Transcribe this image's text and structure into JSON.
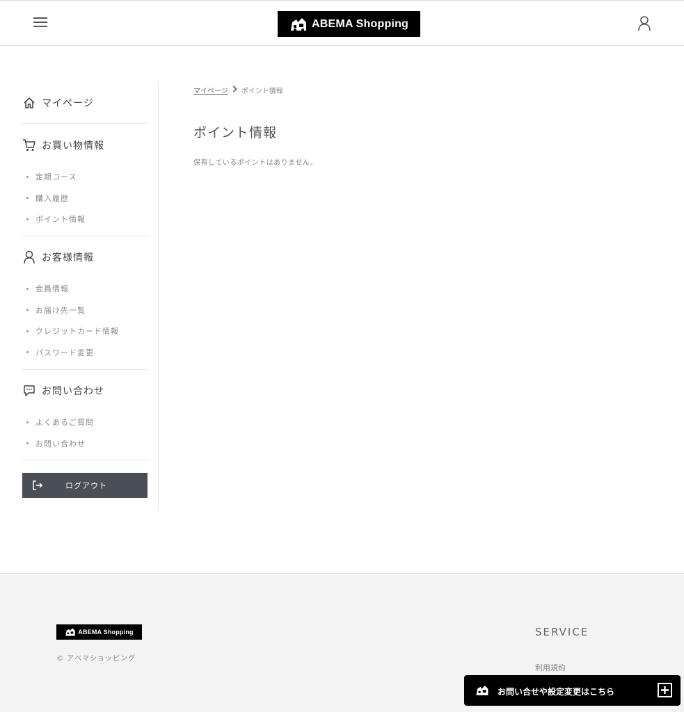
{
  "header": {
    "logo_text": "ABEMA Shopping"
  },
  "sidebar": {
    "home_label": "マイページ",
    "sections": [
      {
        "title": "お買い物情報",
        "items": [
          "定期コース",
          "購入履歴",
          "ポイント情報"
        ]
      },
      {
        "title": "お客様情報",
        "items": [
          "会員情報",
          "お届け先一覧",
          "クレジットカード情報",
          "パスワード変更"
        ]
      },
      {
        "title": "お問い合わせ",
        "items": [
          "よくあるご質問",
          "お問い合わせ"
        ]
      }
    ],
    "logout_label": "ログアウト"
  },
  "main": {
    "breadcrumb": {
      "parent": "マイページ",
      "current": "ポイント情報"
    },
    "title": "ポイント情報",
    "empty_message": "保有しているポイントはありません。"
  },
  "footer": {
    "logo_text": "ABEMA Shopping",
    "copyright": "© アベマショッピング",
    "service_title": "SERVICE",
    "terms_link": "利用規約"
  },
  "contact_bar": {
    "label": "お問い合せや設定変更はこちら"
  },
  "colors": {
    "logo_bg": "#000000",
    "logout_bg": "#4a4f56",
    "footer_bg": "#f3f3f3"
  }
}
